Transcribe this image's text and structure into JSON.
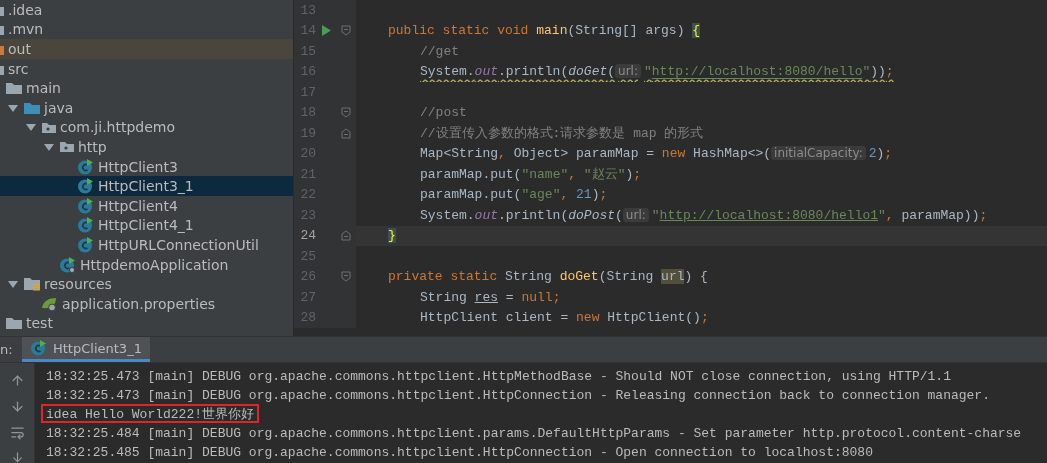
{
  "tree": [
    {
      "label": ".idea",
      "kind": "folder",
      "selected": false,
      "excluded": false
    },
    {
      "label": ".mvn",
      "kind": "folder",
      "selected": false,
      "excluded": false
    },
    {
      "label": "out",
      "kind": "folder",
      "selected": false,
      "excluded": true
    },
    {
      "label": "src",
      "kind": "folder",
      "selected": false,
      "excluded": false,
      "children": [
        {
          "label": "main",
          "kind": "folder",
          "selected": false,
          "children": [
            {
              "label": "java",
              "kind": "source",
              "selected": false,
              "expanded": true,
              "children": [
                {
                  "label": "com.ji.httpdemo",
                  "kind": "package",
                  "selected": false,
                  "expanded": true,
                  "children": [
                    {
                      "label": "http",
                      "kind": "package",
                      "selected": false,
                      "expanded": true,
                      "children": [
                        {
                          "label": "HttpClient3",
                          "kind": "class",
                          "selected": false
                        },
                        {
                          "label": "HttpClient3_1",
                          "kind": "class",
                          "selected": true
                        },
                        {
                          "label": "HttpClient4",
                          "kind": "class",
                          "selected": false
                        },
                        {
                          "label": "HttpClient4_1",
                          "kind": "class",
                          "selected": false
                        },
                        {
                          "label": "HttpURLConnectionUtil",
                          "kind": "class",
                          "selected": false
                        }
                      ]
                    },
                    {
                      "label": "HttpdemoApplication",
                      "kind": "application",
                      "selected": false
                    }
                  ]
                }
              ]
            },
            {
              "label": "resources",
              "kind": "resources",
              "selected": false,
              "expanded": true,
              "children": [
                {
                  "label": "application.properties",
                  "kind": "properties",
                  "selected": false
                }
              ]
            }
          ]
        },
        {
          "label": "test",
          "kind": "folder",
          "selected": false
        }
      ]
    }
  ],
  "editor": {
    "lines": [
      {
        "number": "13",
        "current": false
      },
      {
        "number": "14",
        "current": false,
        "run": true,
        "fold_start": true,
        "kind": "member",
        "tokens": [
          {
            "kind": "kw",
            "text": "public static void "
          },
          {
            "kind": "fn",
            "text": "main"
          },
          {
            "kind": "text",
            "text": "(String[] args) "
          },
          {
            "kind": "brace",
            "text": "{"
          }
        ]
      },
      {
        "number": "15",
        "current": false,
        "kind": "statement",
        "tokens": [
          {
            "kind": "comment",
            "text": "//get"
          }
        ]
      },
      {
        "number": "16",
        "current": false,
        "warning": true,
        "kind": "statement",
        "tokens": [
          {
            "kind": "text",
            "text": "System."
          },
          {
            "kind": "field",
            "text": "out"
          },
          {
            "kind": "text",
            "text": ".println("
          },
          {
            "kind": "call",
            "text": "doGet"
          },
          {
            "kind": "text",
            "text": "("
          },
          {
            "kind": "hint",
            "text": "url:"
          },
          {
            "kind": "str",
            "text": "\""
          },
          {
            "kind": "link",
            "text": "http://localhost:8080/hello"
          },
          {
            "kind": "str",
            "text": "\""
          },
          {
            "kind": "text",
            "text": "))"
          },
          {
            "kind": "kw",
            "text": ";"
          }
        ]
      },
      {
        "number": "17",
        "current": false
      },
      {
        "number": "18",
        "current": false,
        "fold_start": true,
        "kind": "statement",
        "tokens": [
          {
            "kind": "comment",
            "text": "//post"
          }
        ]
      },
      {
        "number": "19",
        "current": false,
        "fold_end": true,
        "kind": "statement",
        "tokens": [
          {
            "kind": "comment",
            "text": "//设置传入参数的格式:请求参数是 map 的形式"
          }
        ]
      },
      {
        "number": "20",
        "current": false,
        "kind": "statement",
        "tokens": [
          {
            "kind": "text",
            "text": "Map<String"
          },
          {
            "kind": "kw",
            "text": ", "
          },
          {
            "kind": "text",
            "text": "Object> paramMap = "
          },
          {
            "kind": "kw",
            "text": "new "
          },
          {
            "kind": "text",
            "text": "HashMap<>("
          },
          {
            "kind": "hint",
            "text": "initialCapacity:"
          },
          {
            "kind": "num",
            "text": "2"
          },
          {
            "kind": "text",
            "text": ")"
          },
          {
            "kind": "kw",
            "text": ";"
          }
        ]
      },
      {
        "number": "21",
        "current": false,
        "kind": "statement",
        "tokens": [
          {
            "kind": "text",
            "text": "paramMap.put("
          },
          {
            "kind": "str",
            "text": "\"name\""
          },
          {
            "kind": "kw",
            "text": ", "
          },
          {
            "kind": "str",
            "text": "\"赵云\""
          },
          {
            "kind": "text",
            "text": ")"
          },
          {
            "kind": "kw",
            "text": ";"
          }
        ]
      },
      {
        "number": "22",
        "current": false,
        "kind": "statement",
        "tokens": [
          {
            "kind": "text",
            "text": "paramMap.put("
          },
          {
            "kind": "str",
            "text": "\"age\""
          },
          {
            "kind": "kw",
            "text": ", "
          },
          {
            "kind": "num",
            "text": "21"
          },
          {
            "kind": "text",
            "text": ")"
          },
          {
            "kind": "kw",
            "text": ";"
          }
        ]
      },
      {
        "number": "23",
        "current": false,
        "kind": "statement",
        "tokens": [
          {
            "kind": "text",
            "text": "System."
          },
          {
            "kind": "field",
            "text": "out"
          },
          {
            "kind": "text",
            "text": ".println("
          },
          {
            "kind": "call",
            "text": "doPost"
          },
          {
            "kind": "text",
            "text": "("
          },
          {
            "kind": "hint",
            "text": "url:"
          },
          {
            "kind": "str",
            "text": "\""
          },
          {
            "kind": "link",
            "text": "http://localhost:8080/hello1"
          },
          {
            "kind": "str",
            "text": "\""
          },
          {
            "kind": "kw",
            "text": ", "
          },
          {
            "kind": "text",
            "text": "paramMap))"
          },
          {
            "kind": "kw",
            "text": ";"
          }
        ]
      },
      {
        "number": "24",
        "current": true,
        "fold_end": true,
        "kind": "member",
        "tokens": [
          {
            "kind": "brace",
            "text": "}"
          }
        ]
      },
      {
        "number": "25",
        "current": false
      },
      {
        "number": "26",
        "current": false,
        "fold_start": true,
        "kind": "member",
        "tokens": [
          {
            "kind": "kw",
            "text": "private static "
          },
          {
            "kind": "text",
            "text": "String "
          },
          {
            "kind": "fn",
            "text": "doGet"
          },
          {
            "kind": "text",
            "text": "(String "
          },
          {
            "kind": "usage",
            "text": "url"
          },
          {
            "kind": "text",
            "text": ") {"
          }
        ]
      },
      {
        "number": "27",
        "current": false,
        "kind": "statement",
        "tokens": [
          {
            "kind": "text",
            "text": "String "
          },
          {
            "kind": "under",
            "text": "res"
          },
          {
            "kind": "text",
            "text": " = "
          },
          {
            "kind": "kw",
            "text": "null;"
          }
        ]
      },
      {
        "number": "28",
        "current": false,
        "kind": "statement",
        "tokens": [
          {
            "kind": "text",
            "text": "HttpClient client = "
          },
          {
            "kind": "kw",
            "text": "new "
          },
          {
            "kind": "text",
            "text": "HttpClient()"
          },
          {
            "kind": "kw",
            "text": ";"
          }
        ]
      }
    ]
  },
  "run_panel": {
    "label": "n:",
    "tabs": [
      {
        "label": "HttpClient3_1",
        "selected": true
      }
    ],
    "console": [
      {
        "text": "18:32:25.473 [main] DEBUG org.apache.commons.httpclient.HttpMethodBase - Should NOT close connection, using HTTP/1.1",
        "boxed": false
      },
      {
        "text": "18:32:25.473 [main] DEBUG org.apache.commons.httpclient.HttpConnection - Releasing connection back to connection manager.",
        "boxed": false
      },
      {
        "text": "idea Hello World222!世界你好",
        "boxed": true
      },
      {
        "text": "18:32:25.484 [main] DEBUG org.apache.commons.httpclient.params.DefaultHttpParams - Set parameter http.protocol.content-charse",
        "boxed": false
      },
      {
        "text": "18:32:25.485 [main] DEBUG org.apache.commons.httpclient.HttpConnection - Open connection to localhost:8080",
        "boxed": false
      }
    ]
  }
}
